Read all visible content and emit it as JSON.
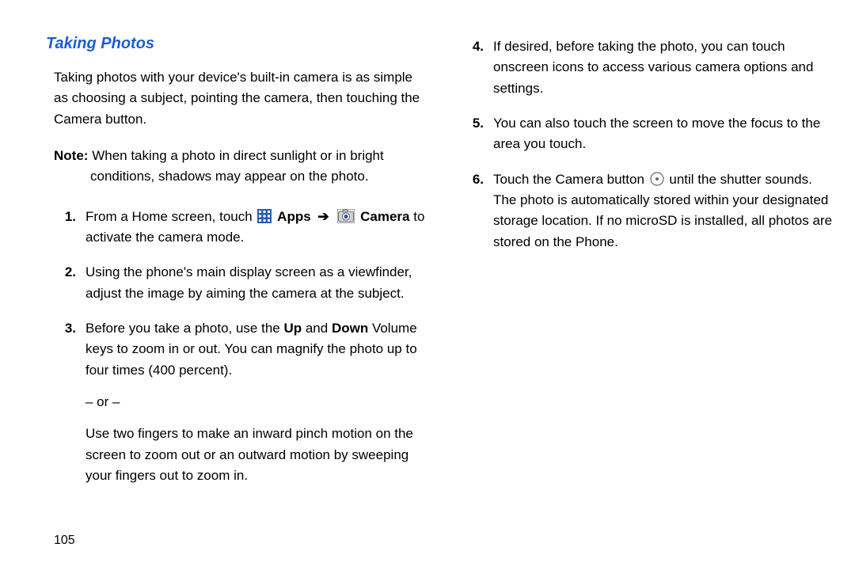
{
  "heading": "Taking Photos",
  "intro": "Taking photos with your device's built-in camera is as simple as choosing a subject, pointing the camera, then touching the Camera button.",
  "note_label": "Note:",
  "note_line1": "When taking a photo in direct sunlight or in bright",
  "note_line2": "conditions, shadows may appear on the photo.",
  "steps": {
    "s1": {
      "num": "1.",
      "pre": "From a Home screen, touch",
      "apps": "Apps",
      "arrow": "➔",
      "camera": "Camera",
      "post": "to activate the camera mode."
    },
    "s2": {
      "num": "2.",
      "text": "Using the phone's main display screen as a viewfinder, adjust the image by aiming the camera at the subject."
    },
    "s3": {
      "num": "3.",
      "pre": "Before you take a photo, use the ",
      "up": "Up",
      "mid": " and ",
      "down": "Down",
      "post": " Volume keys to zoom in or out. You can magnify the photo up to four times (400 percent).",
      "or": "– or –",
      "alt": "Use two fingers to make an inward pinch motion on the screen to zoom out or an outward motion by sweeping your fingers out to zoom in."
    },
    "s4": {
      "num": "4.",
      "text": "If desired, before taking the photo, you can touch onscreen icons to access various camera options and settings."
    },
    "s5": {
      "num": "5.",
      "text": "You can also touch the screen to move the focus to the area you touch."
    },
    "s6": {
      "num": "6.",
      "pre": "Touch the Camera button ",
      "post": " until the shutter sounds. The photo is automatically stored within your designated storage location. If no microSD is installed, all photos are stored on the Phone."
    }
  },
  "page_number": "105"
}
